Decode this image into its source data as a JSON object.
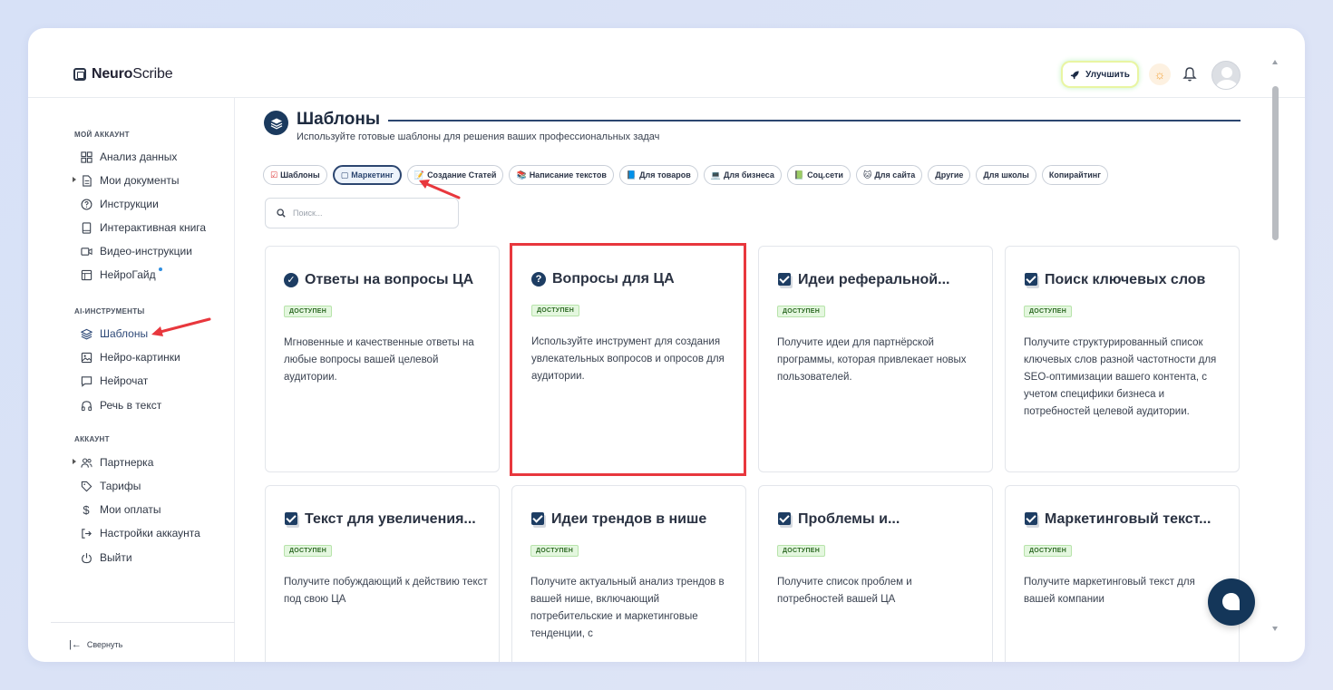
{
  "app": {
    "logo_bold": "Neuro",
    "logo_rest": "Scribe"
  },
  "header": {
    "upgrade_label": "Улучшить"
  },
  "sidebar": {
    "sections": [
      {
        "title": "МОЙ АККАУНТ"
      },
      {
        "title": "AI-ИНСТРУМЕНТЫ"
      },
      {
        "title": "АККАУНТ"
      }
    ],
    "items": [
      {
        "label": "Анализ данных",
        "icon": "grid-icon"
      },
      {
        "label": "Мои документы",
        "icon": "document-icon"
      },
      {
        "label": "Инструкции",
        "icon": "help-circle-icon"
      },
      {
        "label": "Интерактивная книга",
        "icon": "book-icon"
      },
      {
        "label": "Видео-инструкции",
        "icon": "video-icon"
      },
      {
        "label": "НейроГайд",
        "icon": "guide-icon"
      },
      {
        "label": "Шаблоны",
        "icon": "layers-icon"
      },
      {
        "label": "Нейро-картинки",
        "icon": "image-icon"
      },
      {
        "label": "Нейрочат",
        "icon": "chat-icon"
      },
      {
        "label": "Речь в текст",
        "icon": "headphones-icon"
      },
      {
        "label": "Партнерка",
        "icon": "users-icon"
      },
      {
        "label": "Тарифы",
        "icon": "tag-icon"
      },
      {
        "label": "Мои оплаты",
        "icon": "dollar-icon"
      },
      {
        "label": "Настройки аккаунта",
        "icon": "login-icon"
      },
      {
        "label": "Выйти",
        "icon": "power-icon"
      }
    ],
    "collapse_label": "Свернуть"
  },
  "main": {
    "title": "Шаблоны",
    "subtitle": "Используйте готовые шаблоны для решения ваших профессиональных задач",
    "chips": [
      {
        "label": "Шаблоны",
        "emoji": "☑"
      },
      {
        "label": "Маркетинг",
        "emoji": "▢"
      },
      {
        "label": "Создание Статей",
        "emoji": "📝"
      },
      {
        "label": "Написание текстов",
        "emoji": "📚"
      },
      {
        "label": "Для товаров",
        "emoji": "📘"
      },
      {
        "label": "Для бизнеса",
        "emoji": "💻"
      },
      {
        "label": "Соц.сети",
        "emoji": "📗"
      },
      {
        "label": "Для сайта",
        "emoji": "🐱"
      },
      {
        "label": "Другие",
        "emoji": ""
      },
      {
        "label": "Для школы",
        "emoji": ""
      },
      {
        "label": "Копирайтинг",
        "emoji": ""
      }
    ],
    "search_placeholder": "Поиск...",
    "badge_label": "ДОСТУПЕН",
    "cards": [
      {
        "title": "Ответы на вопросы ЦА",
        "desc": "Мгновенные и качественные ответы на любые вопросы вашей целевой аудитории."
      },
      {
        "title": "Вопросы для ЦА",
        "desc": "Используйте инструмент для создания увлекательных вопросов и опросов для аудитории."
      },
      {
        "title": "Идеи реферальной...",
        "desc": "Получите идеи для партнёрской программы, которая привлекает новых пользователей."
      },
      {
        "title": "Поиск ключевых слов",
        "desc": "Получите структурированный список ключевых слов разной частотности для SEO-оптимизации вашего контента, с учетом специфики бизнеса и потребностей целевой аудитории."
      },
      {
        "title": "Текст для увеличения...",
        "desc": "Получите побуждающий к действию текст под свою ЦА"
      },
      {
        "title": "Идеи трендов в нише",
        "desc": "Получите актуальный анализ трендов в вашей нише, включающий потребительские и маркетинговые тенденции, с"
      },
      {
        "title": "Проблемы и...",
        "desc": "Получите список проблем и потребностей вашей ЦА"
      },
      {
        "title": "Маркетинговый текст...",
        "desc": "Получите маркетинговый текст для вашей компании"
      }
    ]
  },
  "colors": {
    "accent": "#1d3d63",
    "highlight": "#e8373d",
    "badge_bg": "#e4f7df"
  }
}
